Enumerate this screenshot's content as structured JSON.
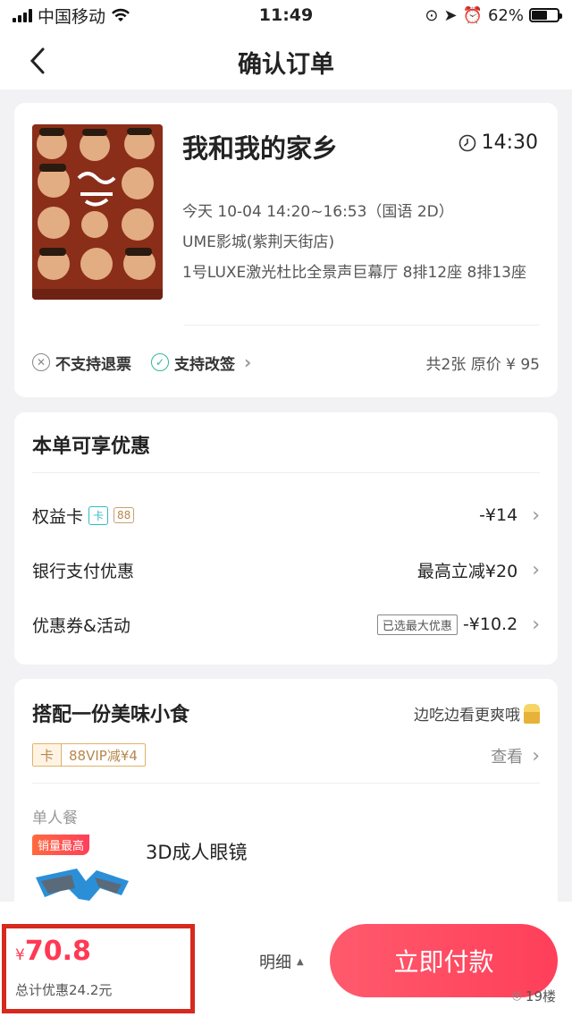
{
  "status_bar": {
    "carrier": "中国移动",
    "time": "11:49",
    "battery": "62%",
    "battery_level": 0.62
  },
  "nav": {
    "title": "确认订单"
  },
  "movie": {
    "title": "我和我的家乡",
    "showtime": "14:30",
    "schedule": "今天 10-04 14:20~16:53（国语 2D）",
    "cinema": "UME影城(紫荆天街店)",
    "seats": "1号LUXE激光杜比全景声巨幕厅 8排12座 8排13座",
    "no_refund": "不支持退票",
    "reschedule": "支持改签",
    "summary": "共2张 原价 ¥ 95"
  },
  "discounts": {
    "title": "本单可享优惠",
    "rows": [
      {
        "label": "权益卡",
        "tag1": "卡",
        "tag2": "88",
        "value": "-¥14"
      },
      {
        "label": "银行支付优惠",
        "value": "最高立减¥20"
      },
      {
        "label": "优惠券&活动",
        "tag": "已选最大优惠",
        "value": "-¥10.2"
      }
    ]
  },
  "snack": {
    "title": "搭配一份美味小食",
    "slogan": "边吃边看更爽哦",
    "vip_tag_k": "卡",
    "vip_tag_text": "88VIP减¥4",
    "view_label": "查看",
    "category": "单人餐",
    "hot_badge": "销量最高",
    "product_name": "3D成人眼镜"
  },
  "bottom": {
    "currency": "¥",
    "price": "70.8",
    "discount_total": "总计优惠24.2元",
    "detail_label": "明细",
    "pay_label": "立即付款",
    "watermark": "19楼"
  }
}
